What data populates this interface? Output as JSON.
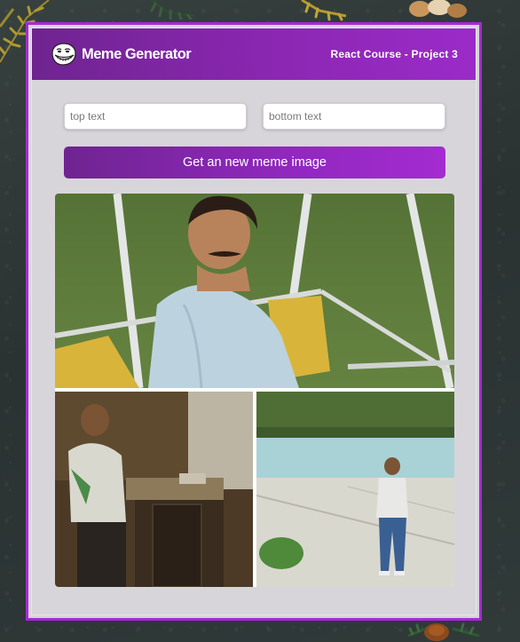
{
  "header": {
    "logo_icon": "troll-face-icon",
    "title": "Meme Generator",
    "subtitle": "React Course - Project 3"
  },
  "form": {
    "top_text": {
      "value": "",
      "placeholder": "top text"
    },
    "bottom_text": {
      "value": "",
      "placeholder": "bottom text"
    },
    "submit_label": "Get an new meme image"
  },
  "meme": {
    "description_icon": "meme-image",
    "top_caption": "",
    "bottom_caption": ""
  },
  "colors": {
    "accent": "#9b2bc8",
    "accent_dark": "#6f2490",
    "card_background": "#d7d5da",
    "border": "#a72ad4"
  }
}
